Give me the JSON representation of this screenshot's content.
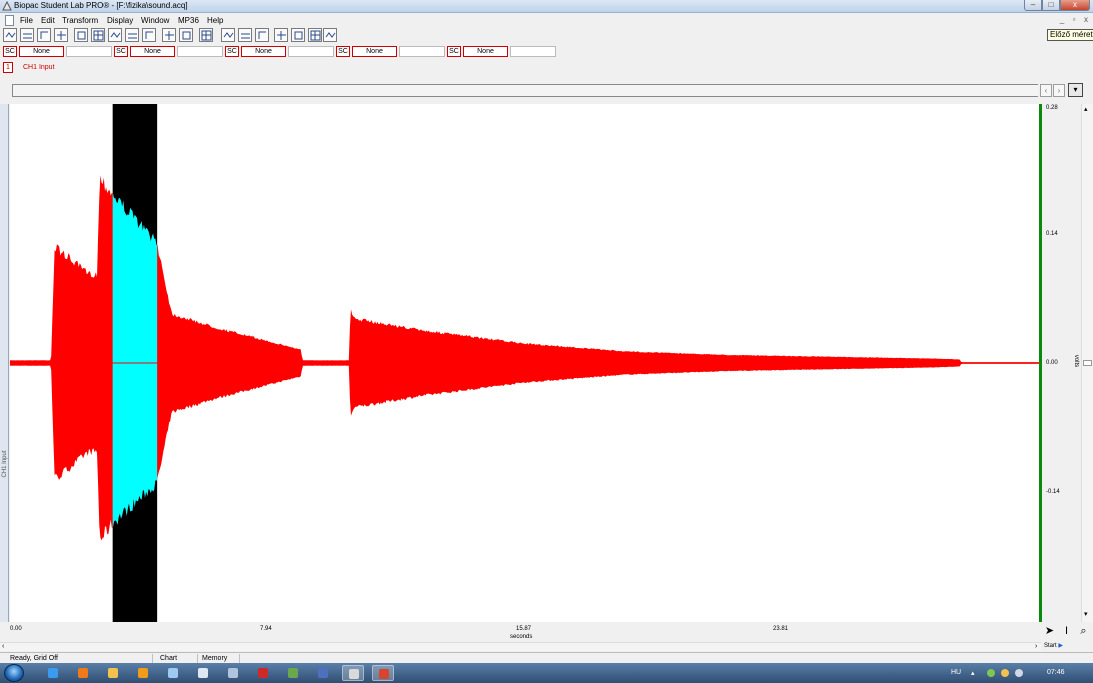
{
  "window": {
    "title": "Biopac Student Lab PRO® - [F:\\fizika\\sound.acq]",
    "controls": {
      "minimize": "–",
      "maximize": "□",
      "close": "x"
    },
    "mdi_controls": {
      "minimize": "_",
      "restore": "▫",
      "close": "x"
    }
  },
  "tooltip": "Előző méret",
  "menu": [
    "File",
    "Edit",
    "Transform",
    "Display",
    "Window",
    "MP36",
    "Help"
  ],
  "toolbar": {
    "icons": [
      "overlap-icon",
      "split-icon",
      "autoscale-waveforms-icon",
      "autoscale-horizontal-icon",
      "zoom-fit-icon",
      "grid-icon",
      "marker-icon",
      "zoom-back-icon",
      "zoom-forward-icon",
      "find-peak-icon",
      "auto-peak-icon",
      "print-icon",
      "data-view-icon",
      "sum-icon",
      "calculator-icon",
      "flag-icon",
      "journal-icon",
      "graph-icon",
      "rewind-icon"
    ]
  },
  "measurements": [
    {
      "channel": "SC",
      "function": "None",
      "value": ""
    },
    {
      "channel": "SC",
      "function": "None",
      "value": ""
    },
    {
      "channel": "SC",
      "function": "None",
      "value": ""
    },
    {
      "channel": "SC",
      "function": "None",
      "value": ""
    },
    {
      "channel": "SC",
      "function": "None",
      "value": ""
    }
  ],
  "channel": {
    "number": "1",
    "label": "CH1 Input",
    "vertical_label": "CH1 Input"
  },
  "journal": {
    "prev": "‹",
    "next": "›",
    "dropdown": "▾"
  },
  "plot": {
    "waveform_color": "#ff0000",
    "selection_color": "#00ffff",
    "selection_bg": "#000000",
    "marker_color": "#0a8a0a"
  },
  "chart_data": {
    "type": "line",
    "x_unit": "seconds",
    "y_unit": "volts",
    "x_ticks": [
      "0.00",
      "7.94",
      "15.87",
      "23.81"
    ],
    "y_ticks": [
      "0.28",
      "0.14",
      "0.00",
      "-0.14"
    ],
    "xlim": [
      0,
      30.1
    ],
    "ylim": [
      -0.28,
      0.28
    ],
    "grid": false,
    "selection": [
      3.0,
      4.3
    ],
    "envelope": {
      "t": [
        0,
        1.2,
        1.3,
        1.35,
        2.3,
        2.55,
        2.62,
        3.0,
        4.3,
        4.7,
        4.75,
        6.0,
        7.0,
        8.5,
        8.55,
        9.9,
        9.95,
        10.05,
        12.0,
        15.0,
        18.0,
        21.0,
        24.0,
        27.0,
        27.75,
        27.8,
        30.1
      ],
      "upper": [
        0.003,
        0.003,
        0.125,
        0.13,
        0.1,
        0.1,
        0.21,
        0.19,
        0.135,
        0.06,
        0.055,
        0.04,
        0.03,
        0.015,
        0.003,
        0.003,
        0.06,
        0.05,
        0.037,
        0.022,
        0.013,
        0.009,
        0.007,
        0.005,
        0.004,
        0.001,
        0.001
      ],
      "lower": [
        -0.003,
        -0.003,
        -0.125,
        -0.13,
        -0.1,
        -0.1,
        -0.2,
        -0.18,
        -0.135,
        -0.06,
        -0.055,
        -0.04,
        -0.03,
        -0.015,
        -0.003,
        -0.003,
        -0.06,
        -0.05,
        -0.037,
        -0.022,
        -0.013,
        -0.009,
        -0.007,
        -0.005,
        -0.004,
        -0.001,
        -0.001
      ]
    }
  },
  "controls": {
    "start": "Start",
    "cursor_tools": [
      "arrow-tool-icon",
      "ibeam-tool-icon",
      "zoom-tool-icon"
    ]
  },
  "status": {
    "message": "Ready, Grid Off",
    "mode": "Chart",
    "memory": "Memory"
  },
  "taskbar": {
    "language": "HU",
    "clock": "07:46",
    "apps": [
      {
        "name": "ie-icon",
        "color": "#3a9cf0",
        "active": false
      },
      {
        "name": "firefox-icon",
        "color": "#f07a1a",
        "active": false
      },
      {
        "name": "explorer-icon",
        "color": "#f2c14e",
        "active": false
      },
      {
        "name": "media-player-icon",
        "color": "#f29b1b",
        "active": false
      },
      {
        "name": "notepad-icon",
        "color": "#9ec9f0",
        "active": false
      },
      {
        "name": "document-icon",
        "color": "#dfe8f2",
        "active": false
      },
      {
        "name": "speaker-app-icon",
        "color": "#b0c4de",
        "active": false
      },
      {
        "name": "network-app-icon",
        "color": "#cc2a2a",
        "active": false
      },
      {
        "name": "puzzle-app-icon",
        "color": "#6aa84f",
        "active": false
      },
      {
        "name": "disk-app-icon",
        "color": "#4f6fbf",
        "active": false
      },
      {
        "name": "biopac-task-icon",
        "color": "#d9d9d9",
        "active": true
      },
      {
        "name": "red-app-icon",
        "color": "#d9442c",
        "active": true
      }
    ]
  }
}
